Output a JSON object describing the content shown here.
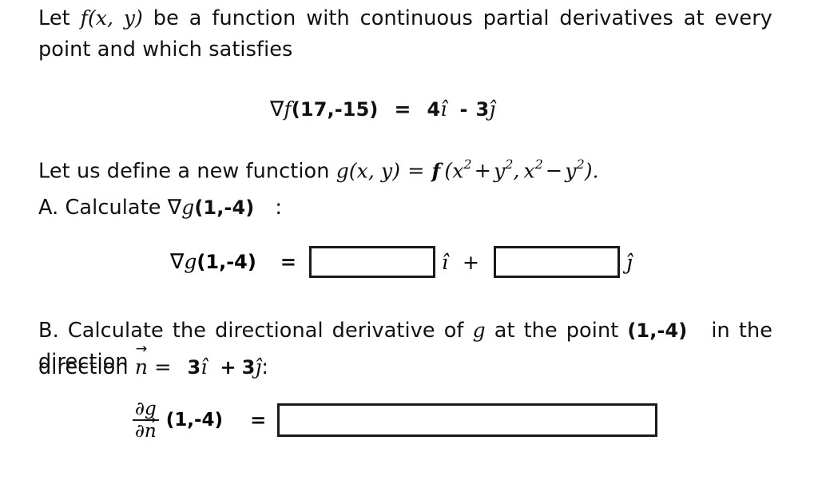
{
  "problem": {
    "intro": {
      "before_f": "Let ",
      "f_expr": "f(x, y)",
      "after_f": " be a function with continuous partial derivatives at every point and which satisfies"
    },
    "gradient_equation": {
      "nabla": "∇",
      "function": "f",
      "point": "(17,-15)",
      "equals": "=",
      "i_coefficient": "4",
      "i_hat": "ı̂",
      "sign": "-",
      "j_coefficient": "3",
      "j_hat": "ȷ̂"
    },
    "definition": {
      "lead": "Let us define a new function ",
      "g_name": "g",
      "g_args": "(x, y)",
      "equals": "=",
      "f_name": "f",
      "open_paren": "(",
      "first_arg_base1": "x",
      "first_arg_exp1": "2",
      "plus": "+",
      "first_arg_base2": "y",
      "first_arg_exp2": "2",
      "comma": ",",
      "second_arg_base1": "x",
      "second_arg_exp1": "2",
      "minus": "−",
      "second_arg_base2": "y",
      "second_arg_exp2": "2",
      "close_paren": ")",
      "period": "."
    },
    "part_a": {
      "label": "A. Calculate ",
      "nabla": "∇",
      "g_name": "g",
      "point": "(1,-4)",
      "colon": ":",
      "answer": {
        "nabla": "∇",
        "g_name": "g",
        "point": "(1,-4)",
        "equals": "=",
        "box_i_value": "",
        "box_i_placeholder": "",
        "i_hat": "ı̂",
        "plus": "+",
        "box_j_value": "",
        "box_j_placeholder": "",
        "j_hat": "ȷ̂"
      }
    },
    "part_b": {
      "text_1": "B. Calculate the directional derivative of ",
      "g_name": "g",
      "text_2": " at the point ",
      "point": "(1,-4)",
      "text_3": "in the direction ",
      "direction_line_lead": "direction ",
      "n_vector": "n",
      "equals": "=",
      "n_i_coefficient": "3",
      "i_hat": "ı̂",
      "plus": "+",
      "n_j_coefficient": "3",
      "j_hat": "ȷ̂",
      "colon": ":",
      "answer": {
        "numerator_partial": "∂",
        "numerator_var": "g",
        "denominator_partial": "∂",
        "denominator_var": "n",
        "point": "(1,-4)",
        "equals": "=",
        "box_value": "",
        "box_placeholder": ""
      }
    }
  },
  "colors": {
    "background": "#ffffff",
    "text": "#101010",
    "box_border": "#1a1a1a"
  }
}
